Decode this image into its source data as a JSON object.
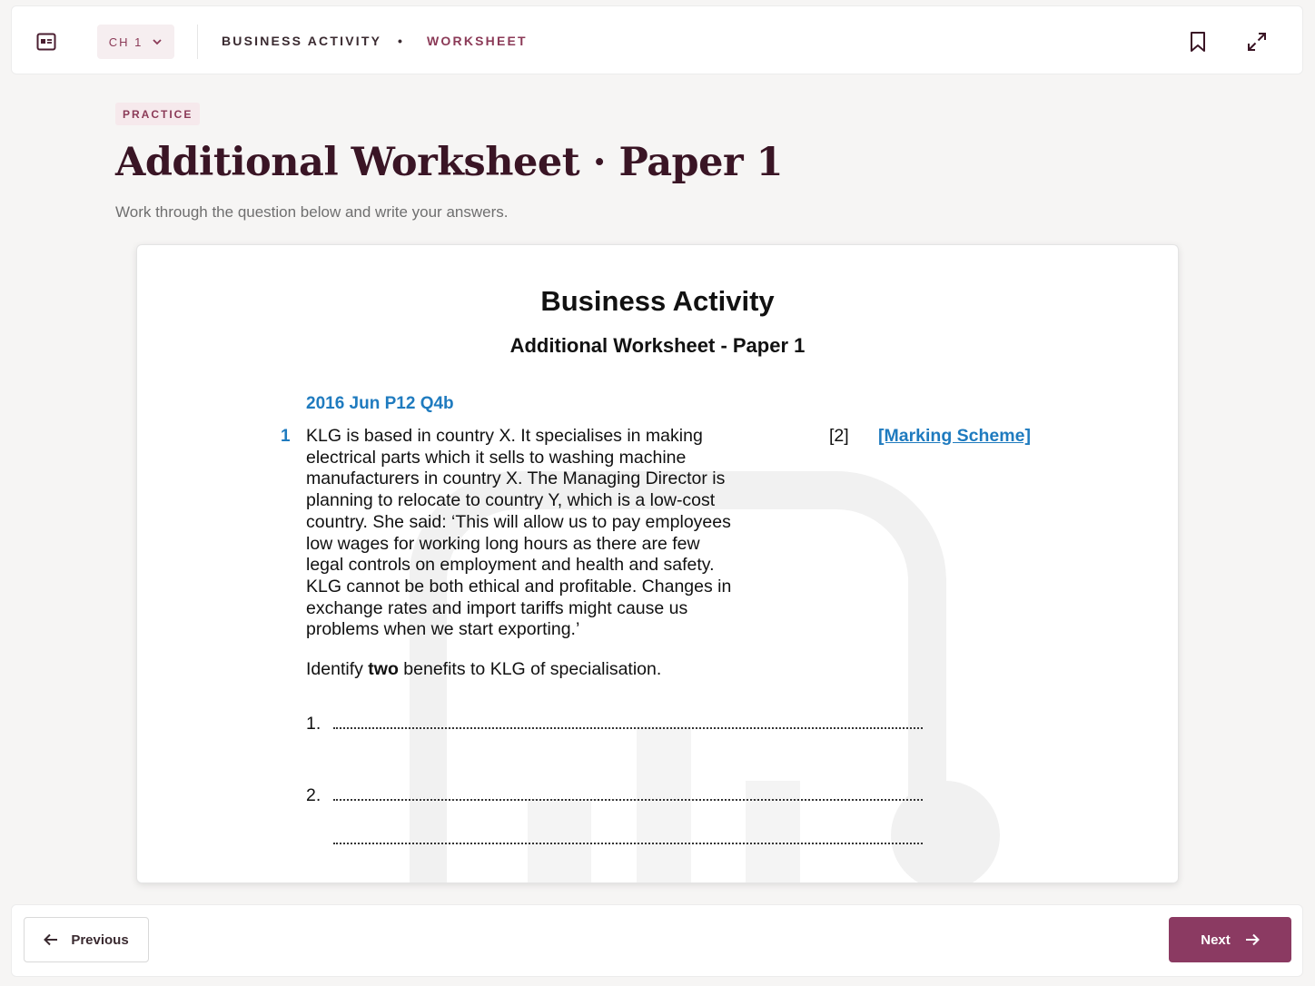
{
  "header": {
    "chapter_label": "CH 1",
    "subject": "BUSINESS ACTIVITY",
    "separator": "•",
    "current": "WORKSHEET",
    "icons": [
      "sidebar-icon",
      "chevron-down-icon",
      "bookmark-icon",
      "expand-icon"
    ]
  },
  "page": {
    "badge": "PRACTICE",
    "title": "Additional Worksheet · Paper 1",
    "subtitle": "Work through the question below and write your answers."
  },
  "document": {
    "title": "Business Activity",
    "subtitle": "Additional Worksheet - Paper 1",
    "question": {
      "ref": "2016 Jun P12 Q4b",
      "number": "1",
      "text": "KLG is based in country X. It specialises in making electrical parts which it sells to washing machine manufacturers in country X. The Managing Director is planning to relocate to country Y, which is a low-cost country. She said: ‘This will allow us to pay employees low wages for working long hours as there are few legal controls on employment and health and safety. KLG cannot be both ethical and profitable. Changes in exchange rates and import tariffs might cause us problems when we start exporting.’",
      "marks": "[2]",
      "marking_scheme_label": "[Marking Scheme]",
      "prompt_before": "Identify ",
      "prompt_bold": "two",
      "prompt_after": " benefits to KLG of specialisation.",
      "answers": [
        "1.",
        "2."
      ]
    }
  },
  "footer": {
    "previous_label": "Previous",
    "next_label": "Next"
  },
  "colors": {
    "accent": "#8b3a57",
    "accent_button": "#8b3a62",
    "title": "#3a1525",
    "link": "#1f7bbf"
  }
}
